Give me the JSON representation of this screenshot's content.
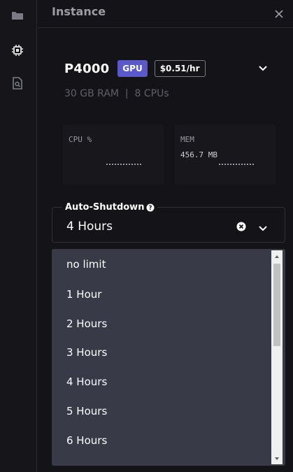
{
  "panel": {
    "title": "Instance"
  },
  "icons": {
    "rail": [
      "folder-icon",
      "chip-icon",
      "notebook-search-icon"
    ],
    "close": "close-icon",
    "expand": "chevron-down-icon",
    "help": "help-icon",
    "clear": "clear-icon"
  },
  "machine": {
    "name": "P4000",
    "badge": "GPU",
    "price": "$0.51/hr",
    "specs": "30 GB RAM  |  8 CPUs"
  },
  "metrics": {
    "cpu": {
      "label": "CPU %",
      "value": ""
    },
    "mem": {
      "label": "MEM",
      "value": "456.7 MB"
    }
  },
  "auto_shutdown": {
    "label": "Auto-Shutdown",
    "selected": "4 Hours",
    "options": [
      "no limit",
      "1 Hour",
      "2 Hours",
      "3 Hours",
      "4 Hours",
      "5 Hours",
      "6 Hours"
    ]
  },
  "colors": {
    "background": "#131316",
    "gpu_badge": "#5b58c9",
    "dropdown_bg": "#383a48",
    "muted_text": "#5f5f6b"
  }
}
